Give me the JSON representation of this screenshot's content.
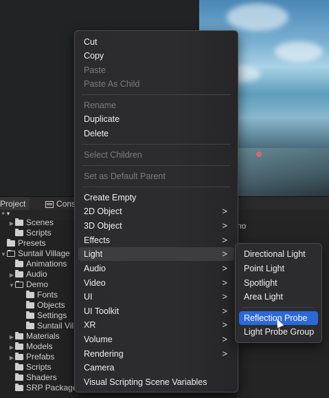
{
  "tabs": {
    "project": "Project",
    "console": "Cons"
  },
  "inspector": {
    "label": "no"
  },
  "tree": [
    {
      "label": "Scenes",
      "indent": 1,
      "arrow": true,
      "open": false
    },
    {
      "label": "Scripts",
      "indent": 1,
      "arrow": false,
      "open": false
    },
    {
      "label": "Presets",
      "indent": 0,
      "arrow": false,
      "open": false
    },
    {
      "label": "Suntail Village",
      "indent": 0,
      "arrow": true,
      "open": true
    },
    {
      "label": "Animations",
      "indent": 1,
      "arrow": false,
      "open": false
    },
    {
      "label": "Audio",
      "indent": 1,
      "arrow": true,
      "open": false
    },
    {
      "label": "Demo",
      "indent": 1,
      "arrow": true,
      "open": true
    },
    {
      "label": "Fonts",
      "indent": 2,
      "arrow": false,
      "open": false
    },
    {
      "label": "Objects",
      "indent": 2,
      "arrow": false,
      "open": false
    },
    {
      "label": "Settings",
      "indent": 2,
      "arrow": false,
      "open": false
    },
    {
      "label": "Suntail Vil",
      "indent": 2,
      "arrow": false,
      "open": false
    },
    {
      "label": "Materials",
      "indent": 1,
      "arrow": true,
      "open": false
    },
    {
      "label": "Models",
      "indent": 1,
      "arrow": true,
      "open": false
    },
    {
      "label": "Prefabs",
      "indent": 1,
      "arrow": true,
      "open": false
    },
    {
      "label": "Scripts",
      "indent": 1,
      "arrow": false,
      "open": false
    },
    {
      "label": "Shaders",
      "indent": 1,
      "arrow": false,
      "open": false
    },
    {
      "label": "SRP Packages",
      "indent": 1,
      "arrow": false,
      "open": false
    }
  ],
  "menu": {
    "cut": "Cut",
    "copy": "Copy",
    "paste": "Paste",
    "paste_as_child": "Paste As Child",
    "rename": "Rename",
    "duplicate": "Duplicate",
    "delete": "Delete",
    "select_children": "Select Children",
    "set_default_parent": "Set as Default Parent",
    "create_empty": "Create Empty",
    "object_2d": "2D Object",
    "object_3d": "3D Object",
    "effects": "Effects",
    "light": "Light",
    "audio": "Audio",
    "video": "Video",
    "ui": "UI",
    "ui_toolkit": "UI Toolkit",
    "xr": "XR",
    "volume": "Volume",
    "rendering": "Rendering",
    "camera": "Camera",
    "visual_scripting": "Visual Scripting Scene Variables",
    "chevron": ">"
  },
  "light_submenu": {
    "directional": "Directional Light",
    "point": "Point Light",
    "spotlight": "Spotlight",
    "area": "Area Light",
    "reflection_probe": "Reflection Probe",
    "light_probe_group": "Light Probe Group"
  },
  "colors": {
    "selection": "#2c68d6",
    "menu_bg": "#2c2c2e"
  }
}
